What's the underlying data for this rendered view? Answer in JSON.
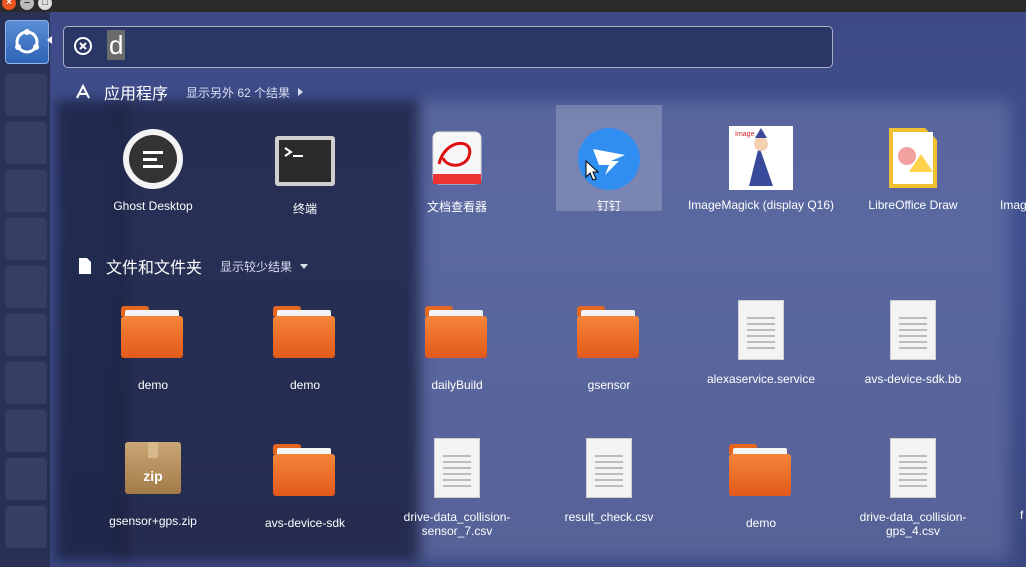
{
  "search": {
    "query": "d"
  },
  "apps_section": {
    "title": "应用程序",
    "more": "显示另外 62 个结果",
    "items": [
      {
        "label": "Ghost Desktop",
        "icon": "ghost-desktop-icon"
      },
      {
        "label": "终端",
        "icon": "terminal-icon"
      },
      {
        "label": "文档查看器",
        "icon": "document-viewer-icon"
      },
      {
        "label": "钉钉",
        "icon": "dingtalk-icon"
      },
      {
        "label": "ImageMagick (display Q16)",
        "icon": "imagemagick-icon"
      },
      {
        "label": "LibreOffice Draw",
        "icon": "libreoffice-draw-icon"
      },
      {
        "label": "Imag",
        "icon": "image-viewer-icon"
      }
    ]
  },
  "files_section": {
    "title": "文件和文件夹",
    "more": "显示较少结果",
    "row1": [
      {
        "label": "demo",
        "type": "folder"
      },
      {
        "label": "demo",
        "type": "folder"
      },
      {
        "label": "dailyBuild",
        "type": "folder"
      },
      {
        "label": "gsensor",
        "type": "folder"
      },
      {
        "label": "alexaservice.service",
        "type": "text"
      },
      {
        "label": "avs-device-sdk.bb",
        "type": "text"
      }
    ],
    "row2": [
      {
        "label": "gsensor+gps.zip",
        "type": "zip"
      },
      {
        "label": "avs-device-sdk",
        "type": "folder"
      },
      {
        "label": "drive-data_collision-sensor_7.csv",
        "type": "text"
      },
      {
        "label": "result_check.csv",
        "type": "text"
      },
      {
        "label": "demo",
        "type": "folder"
      },
      {
        "label": "drive-data_collision-gps_4.csv",
        "type": "text"
      },
      {
        "label": "f",
        "type": "text"
      }
    ]
  },
  "zip_label": "zip",
  "colors": {
    "accent": "#e95420",
    "folder": "#e8641f",
    "panel": "#3d4a86"
  }
}
